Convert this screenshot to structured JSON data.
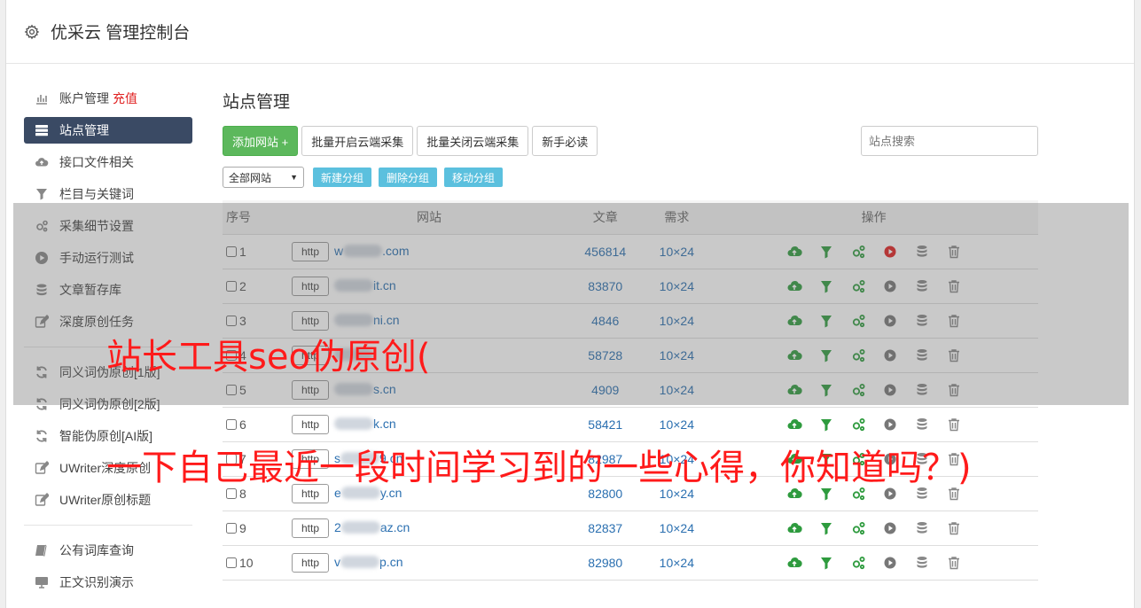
{
  "header": {
    "title": "优采云 管理控制台"
  },
  "sidebar": {
    "group1": [
      {
        "label": "账户管理",
        "tag": "充值",
        "icon": "bar-chart-icon"
      },
      {
        "label": "站点管理",
        "tag": "",
        "icon": "server-list-icon",
        "active": true
      },
      {
        "label": "接口文件相关",
        "tag": "",
        "icon": "cloud-upload-icon"
      },
      {
        "label": "栏目与关键词",
        "tag": "",
        "icon": "filter-icon"
      },
      {
        "label": "采集细节设置",
        "tag": "",
        "icon": "gears-icon"
      },
      {
        "label": "手动运行测试",
        "tag": "",
        "icon": "play-circle-icon"
      },
      {
        "label": "文章暂存库",
        "tag": "",
        "icon": "database-icon"
      },
      {
        "label": "深度原创任务",
        "tag": "",
        "icon": "edit-icon"
      }
    ],
    "group2": [
      {
        "label": "同义词伪原创[1版]",
        "icon": "refresh-icon"
      },
      {
        "label": "同义词伪原创[2版]",
        "icon": "refresh-icon"
      },
      {
        "label": "智能伪原创[AI版]",
        "icon": "refresh-icon"
      },
      {
        "label": "UWriter深度原创",
        "icon": "edit-icon"
      },
      {
        "label": "UWriter原创标题",
        "icon": "edit-icon"
      }
    ],
    "group3": [
      {
        "label": "公有词库查询",
        "icon": "book-icon"
      },
      {
        "label": "正文识别演示",
        "icon": "monitor-icon"
      }
    ]
  },
  "main": {
    "title": "站点管理",
    "toolbar": {
      "add_site": "添加网站 +",
      "batch_open": "批量开启云端采集",
      "batch_close": "批量关闭云端采集",
      "guide": "新手必读",
      "search_placeholder": "站点搜索"
    },
    "group_bar": {
      "select_value": "全部网站",
      "new_group": "新建分组",
      "delete_group": "删除分组",
      "move_group": "移动分组"
    },
    "table": {
      "headers": [
        "序号",
        "网站",
        "文章",
        "需求",
        "操作"
      ],
      "rows": [
        {
          "num": "1",
          "prefix": "w",
          "suffix": ".com",
          "articles": "456814",
          "demand": "10×24",
          "running": true
        },
        {
          "num": "2",
          "prefix": "",
          "suffix": "it.cn",
          "articles": "83870",
          "demand": "10×24",
          "running": false
        },
        {
          "num": "3",
          "prefix": "",
          "suffix": "ni.cn",
          "articles": "4846",
          "demand": "10×24",
          "running": false
        },
        {
          "num": "4",
          "prefix": "",
          "suffix": "",
          "articles": "58728",
          "demand": "10×24",
          "running": false
        },
        {
          "num": "5",
          "prefix": "",
          "suffix": "s.cn",
          "articles": "4909",
          "demand": "10×24",
          "running": false
        },
        {
          "num": "6",
          "prefix": "",
          "suffix": "k.cn",
          "articles": "58421",
          "demand": "10×24",
          "running": false
        },
        {
          "num": "7",
          "prefix": "s",
          "suffix": "9.cn",
          "articles": "82987",
          "demand": "10×24",
          "running": false
        },
        {
          "num": "8",
          "prefix": "e",
          "suffix": "y.cn",
          "articles": "82800",
          "demand": "10×24",
          "running": false
        },
        {
          "num": "9",
          "prefix": "2",
          "suffix": "az.cn",
          "articles": "82837",
          "demand": "10×24",
          "running": false
        },
        {
          "num": "10",
          "prefix": "v",
          "suffix": "p.cn",
          "articles": "82980",
          "demand": "10×24",
          "running": false
        }
      ],
      "http_label": "http"
    }
  },
  "overlay": {
    "caption1": "站长工具seo伪原创(",
    "caption2": "一下自己最近一段时间学习到的一些心得，你知道吗？)"
  },
  "colors": {
    "accent_green": "#5cb85c",
    "info_blue": "#5bc0de",
    "sidebar_active": "#3a4a64",
    "caption_red": "#ff1a1a"
  }
}
